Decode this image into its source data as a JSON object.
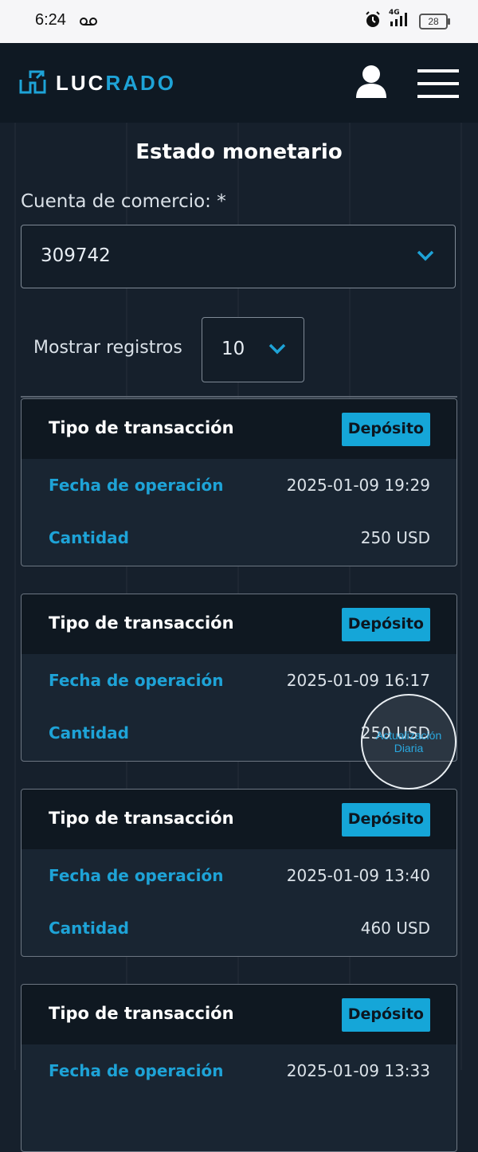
{
  "status_bar": {
    "time": "6:24",
    "network": "4G",
    "battery": "28"
  },
  "header": {
    "logo_part1": "LUC",
    "logo_part2": "RADO"
  },
  "page": {
    "title": "Estado monetario",
    "account_label": "Cuenta de comercio: *",
    "account_value": "309742",
    "records_label": "Mostrar registros",
    "records_value": "10"
  },
  "cards": [
    {
      "type_label": "Tipo de transacción",
      "type_value": "Depósito",
      "date_label": "Fecha de operación",
      "date_value": "2025-01-09 19:29",
      "amount_label": "Cantidad",
      "amount_value": "250 USD"
    },
    {
      "type_label": "Tipo de transacción",
      "type_value": "Depósito",
      "date_label": "Fecha de operación",
      "date_value": "2025-01-09 16:17",
      "amount_label": "Cantidad",
      "amount_value": "250 USD"
    },
    {
      "type_label": "Tipo de transacción",
      "type_value": "Depósito",
      "date_label": "Fecha de operación",
      "date_value": "2025-01-09 13:40",
      "amount_label": "Cantidad",
      "amount_value": "460 USD"
    },
    {
      "type_label": "Tipo de transacción",
      "type_value": "Depósito",
      "date_label": "Fecha de operación",
      "date_value": "2025-01-09 13:33",
      "amount_label": "Cantidad",
      "amount_value": ""
    }
  ],
  "floating_button": {
    "label": "Actualización Diaria"
  },
  "colors": {
    "accent": "#1ea3d7",
    "badge": "#15a6d8",
    "header_bg": "#0f1923",
    "page_bg": "#16202c"
  }
}
